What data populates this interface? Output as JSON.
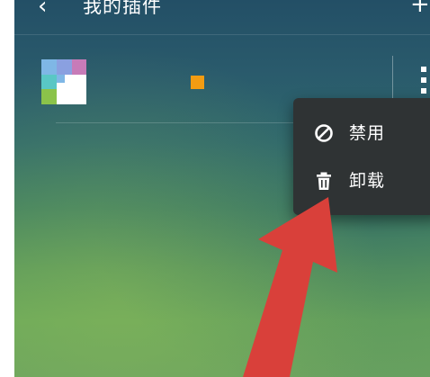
{
  "header": {
    "back_symbol": "‹",
    "title": "我的插件",
    "add_symbol": "+"
  },
  "plugin": {
    "icon_name": "plugin-tile-icon",
    "badge_color": "#f39c12"
  },
  "menu": {
    "items": [
      {
        "icon": "disable-icon",
        "label": "禁用"
      },
      {
        "icon": "trash-icon",
        "label": "卸载"
      }
    ]
  },
  "annotation": {
    "arrow_color": "#d9403a",
    "points_to": "卸载"
  }
}
